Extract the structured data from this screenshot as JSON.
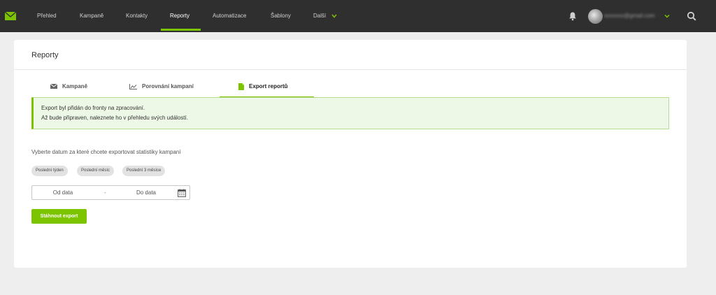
{
  "nav": {
    "items": [
      {
        "label": "Přehled"
      },
      {
        "label": "Kampaně"
      },
      {
        "label": "Kontakty"
      },
      {
        "label": "Reporty"
      },
      {
        "label": "Automatizace"
      },
      {
        "label": "Šablony"
      },
      {
        "label": "Další"
      }
    ],
    "active_index": 3,
    "user_email": "xxxxxxx@gmail.com",
    "accent_color": "#7cc400",
    "icons": [
      "envelope-logo-icon",
      "bell-icon",
      "avatar",
      "chevron-down-icon",
      "search-icon"
    ]
  },
  "page": {
    "title": "Reporty"
  },
  "tabs": [
    {
      "label": "Kampaně",
      "icon": "envelope-icon"
    },
    {
      "label": "Porovnání kampaní",
      "icon": "line-chart-icon"
    },
    {
      "label": "Export reportů",
      "icon": "file-icon"
    }
  ],
  "active_tab": 2,
  "alert": {
    "line1": "Export byl přidán do fronty na zpracování.",
    "line2": "Až bude připraven, naleznete ho v přehledu svých událostí."
  },
  "form": {
    "instruction": "Vyberte datum za které chcete exportovat statistiky kampaní",
    "presets": [
      "Poslední týden",
      "Poslední měsíc",
      "Poslední 3 měsíce"
    ],
    "from_placeholder": "Od data",
    "separator": "-",
    "to_placeholder": "Do data",
    "submit_label": "Stáhnout export"
  }
}
